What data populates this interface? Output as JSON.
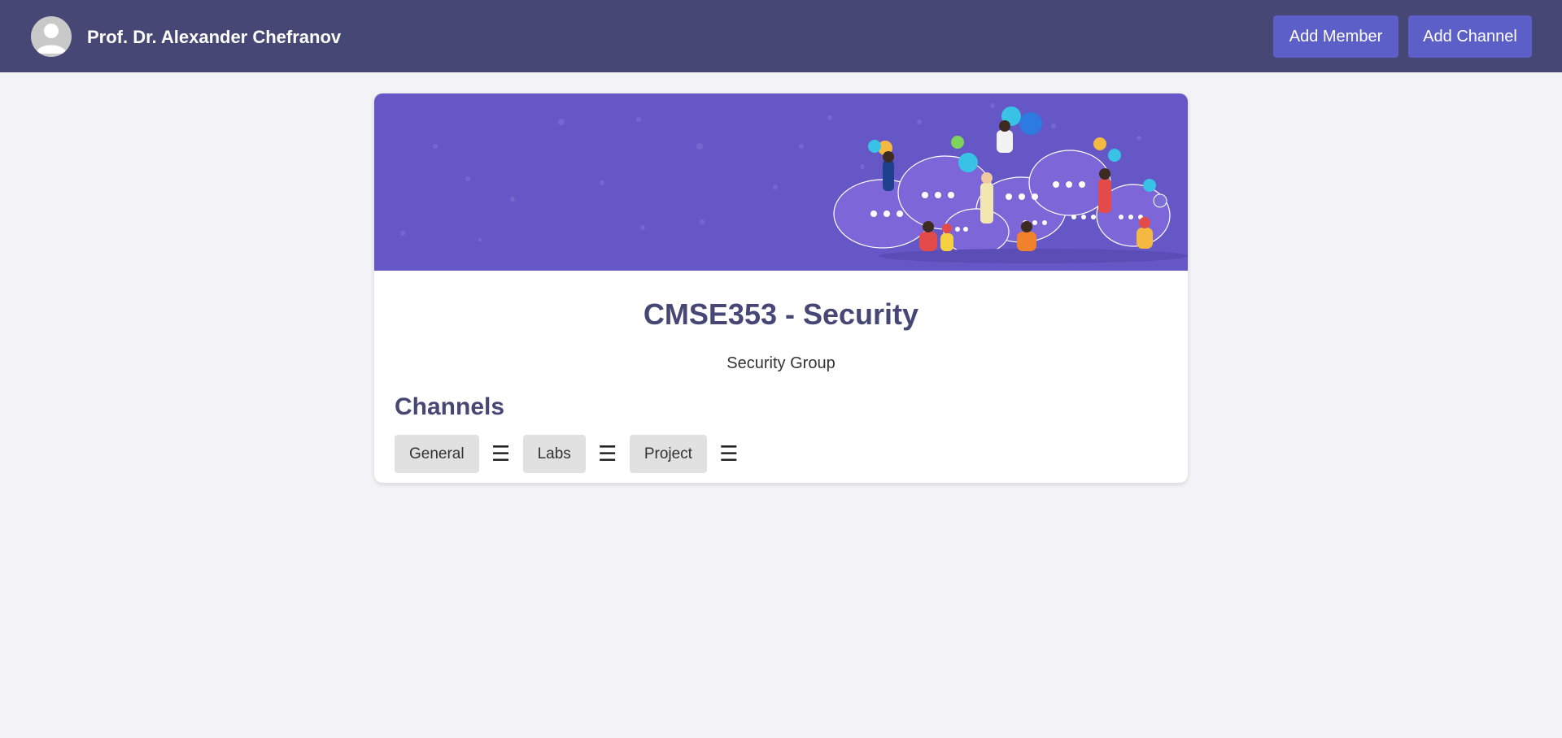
{
  "header": {
    "user_name": "Prof. Dr. Alexander Chefranov",
    "add_member_label": "Add Member",
    "add_channel_label": "Add Channel",
    "avatar_icon": "user-avatar-icon",
    "bar_color": "#464775",
    "button_color": "#5b5fc7"
  },
  "team": {
    "banner_icon": "group-chat-illustration",
    "banner_color": "#6557c5",
    "title": "CMSE353 - Security",
    "description": "Security Group"
  },
  "channels": {
    "heading": "Channels",
    "items": [
      {
        "label": "General",
        "menu_icon": "☰"
      },
      {
        "label": "Labs",
        "menu_icon": "☰"
      },
      {
        "label": "Project",
        "menu_icon": "☰"
      }
    ]
  }
}
